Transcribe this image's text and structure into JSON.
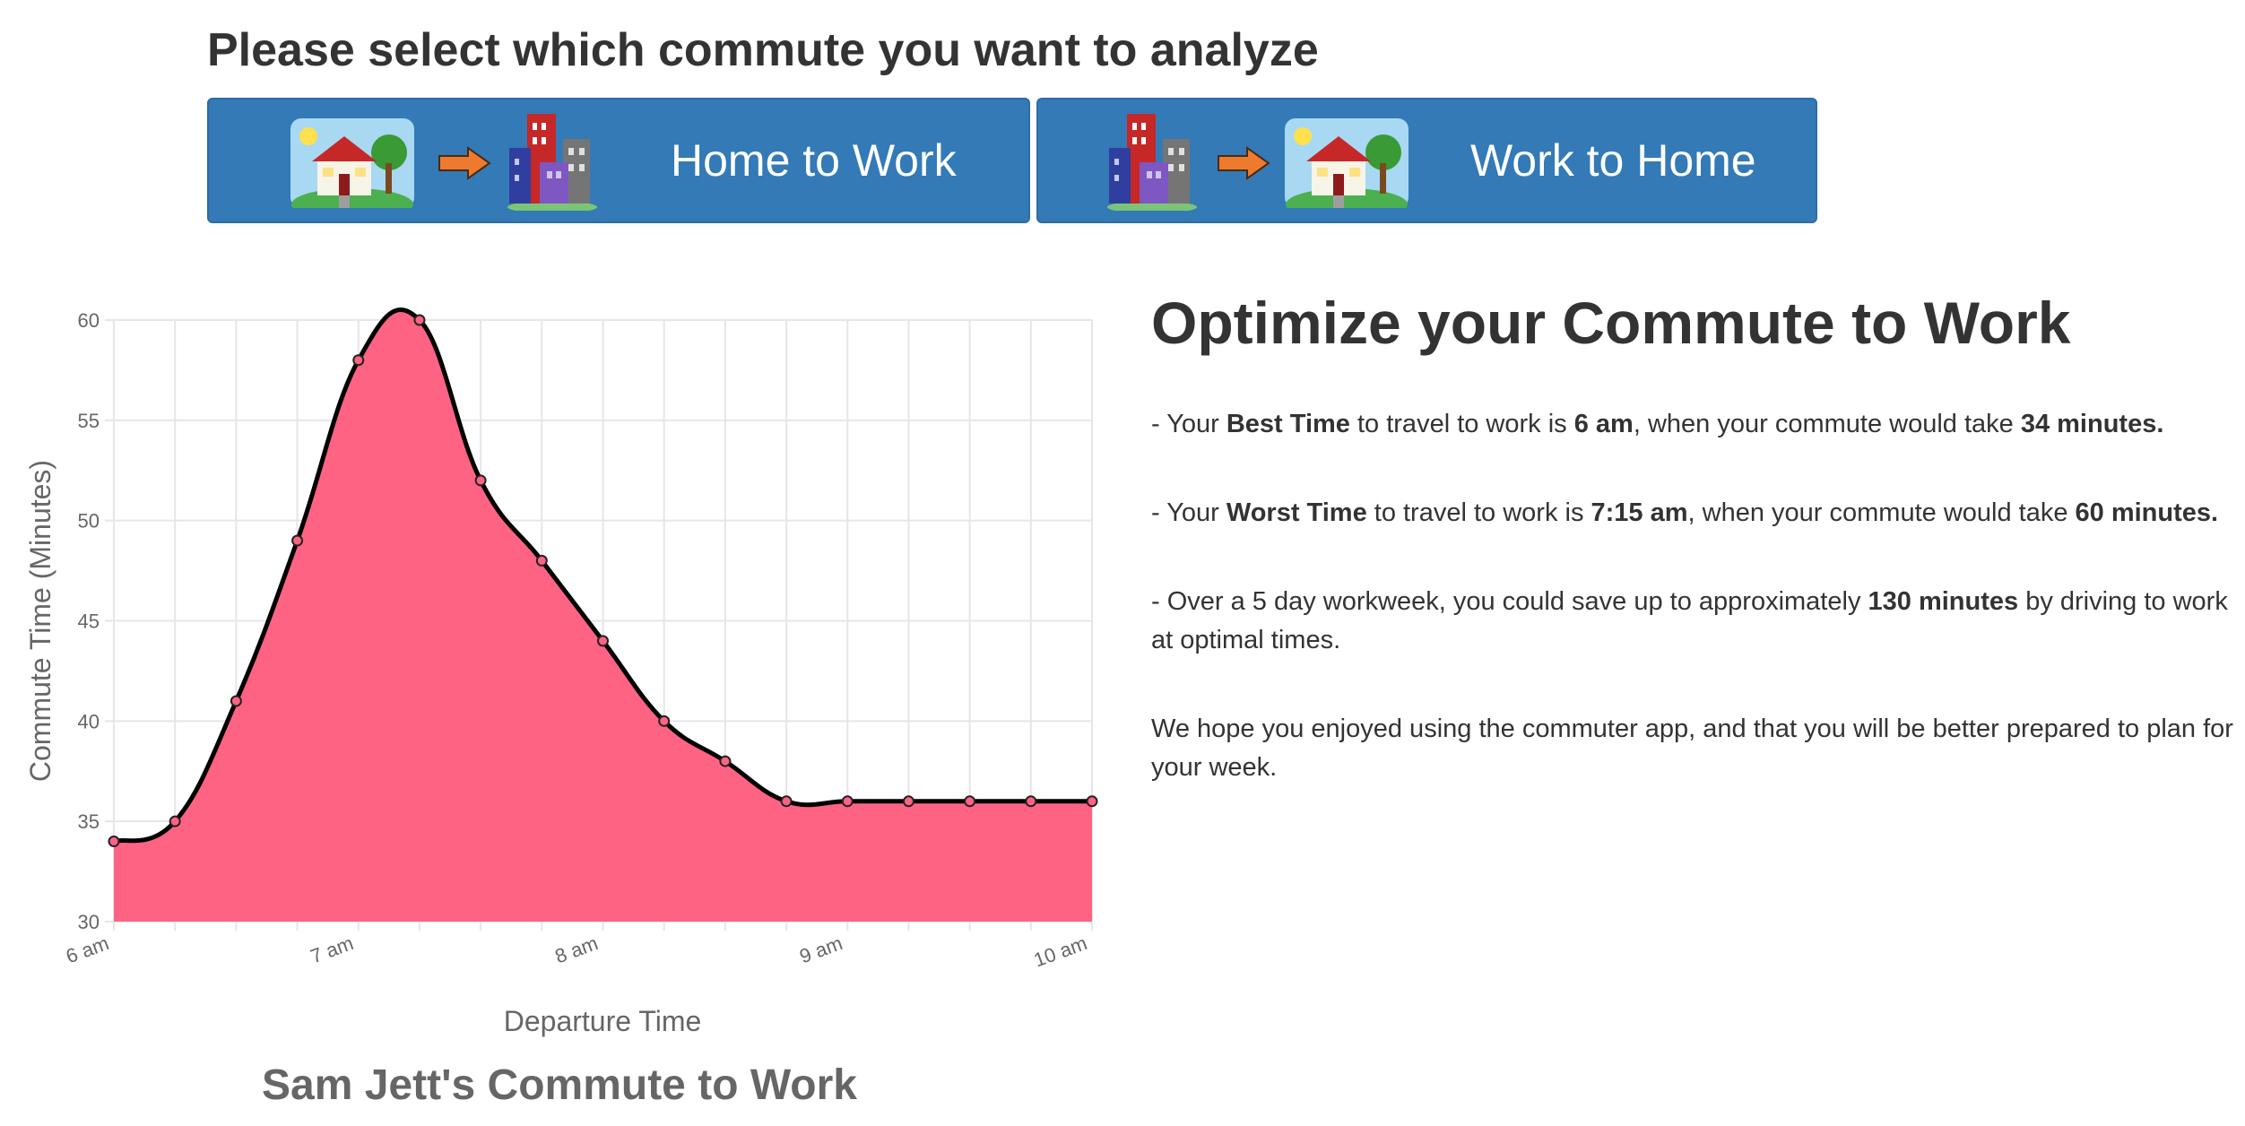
{
  "header": {
    "prompt": "Please select which commute you want to analyze"
  },
  "buttons": {
    "home_to_work_label": "Home to Work",
    "work_to_home_label": "Work to Home",
    "color": "#337ab7"
  },
  "panel": {
    "title": "Optimize your Commute to Work",
    "best": {
      "prefix": "- Your ",
      "label": "Best Time",
      "mid": " to travel to work is ",
      "time": "6 am",
      "mid2": ", when your commute would take ",
      "duration": "34 minutes."
    },
    "worst": {
      "prefix": "- Your ",
      "label": "Worst Time",
      "mid": " to travel to work is ",
      "time": "7:15 am",
      "mid2": ", when your commute would take ",
      "duration": "60 minutes."
    },
    "savings": {
      "prefix": "- Over a 5 day workweek, you could save up to approximately ",
      "amount": "130 minutes",
      "suffix": " by driving to work at optimal times."
    },
    "closing": "We hope you enjoyed using the commuter app, and that you will be better prepared to plan for your week."
  },
  "chart_data": {
    "type": "area",
    "title": "Sam Jett's Commute to Work",
    "xlabel": "Departure Time",
    "ylabel": "Commute Time (Minutes)",
    "x": [
      "6:00",
      "6:15",
      "6:30",
      "6:45",
      "7:00",
      "7:15",
      "7:30",
      "7:45",
      "8:00",
      "8:15",
      "8:30",
      "8:45",
      "9:00",
      "9:15",
      "9:30",
      "9:45",
      "10:00"
    ],
    "x_tick_labels": [
      "6 am",
      "",
      "",
      "",
      "7 am",
      "",
      "",
      "",
      "8 am",
      "",
      "",
      "",
      "9 am",
      "",
      "",
      "",
      "10 am"
    ],
    "values": [
      34,
      35,
      41,
      49,
      58,
      60,
      52,
      48,
      44,
      40,
      38,
      36,
      36,
      36,
      36,
      36,
      36
    ],
    "ylim": [
      30,
      60
    ],
    "y_ticks": [
      30,
      35,
      40,
      45,
      50,
      55,
      60
    ],
    "grid": true,
    "fill_color": "#ff6384",
    "line_color": "#000000"
  }
}
